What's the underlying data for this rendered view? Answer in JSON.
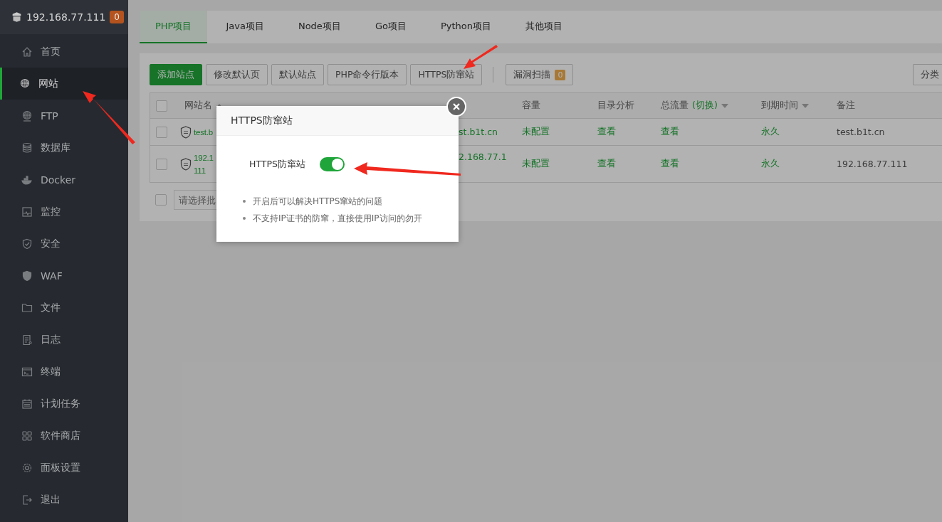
{
  "sidebar": {
    "host": "192.168.77.111",
    "badge": "0",
    "items": [
      {
        "label": "首页",
        "selected": false
      },
      {
        "label": "网站",
        "selected": true
      },
      {
        "label": "FTP",
        "selected": false
      },
      {
        "label": "数据库",
        "selected": false
      },
      {
        "label": "Docker",
        "selected": false
      },
      {
        "label": "监控",
        "selected": false
      },
      {
        "label": "安全",
        "selected": false
      },
      {
        "label": "WAF",
        "selected": false
      },
      {
        "label": "文件",
        "selected": false
      },
      {
        "label": "日志",
        "selected": false
      },
      {
        "label": "终端",
        "selected": false
      },
      {
        "label": "计划任务",
        "selected": false
      },
      {
        "label": "软件商店",
        "selected": false
      },
      {
        "label": "面板设置",
        "selected": false
      },
      {
        "label": "退出",
        "selected": false
      }
    ]
  },
  "tabs": [
    {
      "label": "PHP项目",
      "selected": true
    },
    {
      "label": "Java项目",
      "selected": false
    },
    {
      "label": "Node项目",
      "selected": false
    },
    {
      "label": "Go项目",
      "selected": false
    },
    {
      "label": "Python项目",
      "selected": false
    },
    {
      "label": "其他项目",
      "selected": false
    }
  ],
  "toolbar": {
    "buttons": [
      {
        "label": "添加站点",
        "kind": "primary"
      },
      {
        "label": "修改默认页",
        "kind": "plain"
      },
      {
        "label": "默认站点",
        "kind": "plain"
      },
      {
        "label": "PHP命令行版本",
        "kind": "plain"
      },
      {
        "label": "HTTPS防窜站",
        "kind": "plain"
      }
    ],
    "scan": {
      "label": "漏洞扫描",
      "badge": "0"
    },
    "category": "分类"
  },
  "table": {
    "all_checked": false,
    "columns": [
      {
        "label": "网站名",
        "sort_ascending": true
      },
      {},
      {},
      {},
      {
        "label": "容量"
      },
      {
        "label": "目录分析"
      },
      {
        "label": "总流量",
        "switch": "(切换)",
        "sort_ascending": false
      },
      {
        "label": "到期时间",
        "sort_ascending": false
      },
      {
        "label": "备注"
      }
    ],
    "rows": [
      {
        "checked": false,
        "name": "test.b",
        "root": "st.b1t.cn",
        "capacity": "未配置",
        "dir_analysis": "查看",
        "traffic": "查看",
        "expiry": "永久",
        "note": "test.b1t.cn"
      },
      {
        "checked": false,
        "name": "192.1\n111",
        "root": "2.168.77.1",
        "capacity": "未配置",
        "dir_analysis": "查看",
        "traffic": "查看",
        "expiry": "永久",
        "note": "192.168.77.111"
      }
    ]
  },
  "batch": {
    "checked": false,
    "placeholder": "请选择批"
  },
  "dialog": {
    "title": "HTTPS防窜站",
    "toggle": {
      "label": "HTTPS防窜站",
      "on": true
    },
    "notes": [
      "开启后可以解决HTTPS窜站的问题",
      "不支持IP证书的防窜，直接使用IP访问的勿开"
    ]
  }
}
